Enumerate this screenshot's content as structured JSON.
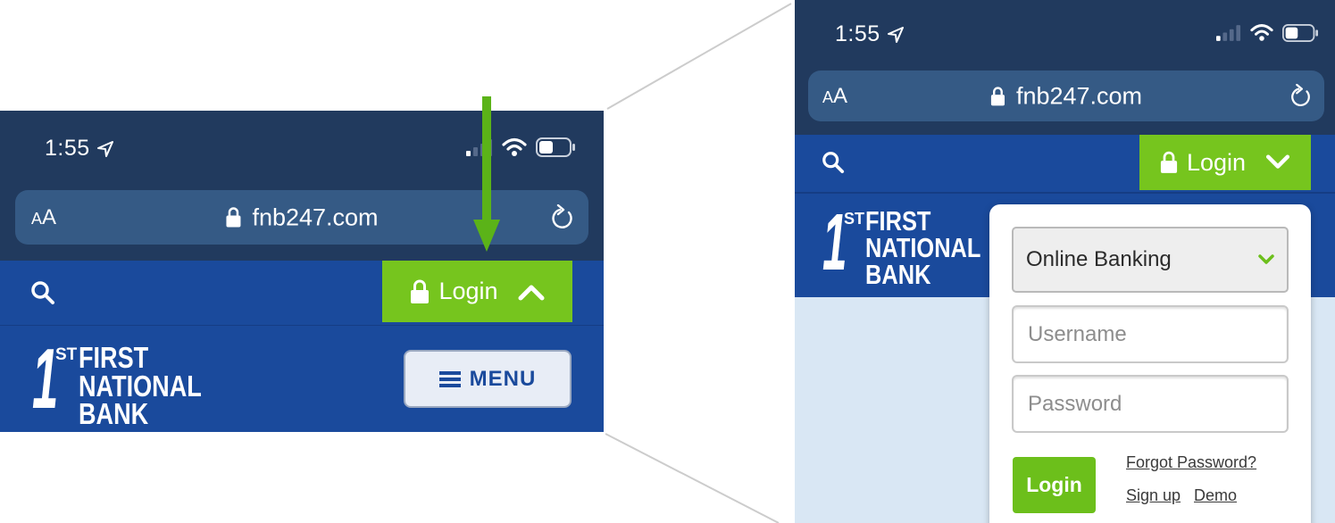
{
  "phone": {
    "time": "1:55",
    "url": "fnb247.com",
    "reader_label_small": "A",
    "reader_label_large": "A"
  },
  "nav": {
    "login_label": "Login",
    "menu_label": "MENU"
  },
  "logo": {
    "numeral": "1",
    "suffix": "ST",
    "line1": "FIRST",
    "line2": "NATIONAL",
    "line3": "BANK"
  },
  "login_panel": {
    "account_type": "Online Banking",
    "username_placeholder": "Username",
    "password_placeholder": "Password",
    "submit_label": "Login",
    "forgot_password": "Forgot Password?",
    "sign_up": "Sign up",
    "demo": "Demo"
  },
  "colors": {
    "status_bar": "#213a5e",
    "url_bar": "#355a85",
    "brand_blue": "#1a4a9c",
    "login_green": "#76c51e",
    "page_background": "#d9e7f4"
  },
  "icons": {
    "location": "location-arrow-icon",
    "signal": "cellular-signal-icon",
    "wifi": "wifi-icon",
    "battery": "battery-icon",
    "lock": "lock-icon",
    "reload": "reload-icon",
    "search": "search-icon",
    "chevron_up": "chevron-up-icon",
    "chevron_down": "chevron-down-icon",
    "hamburger": "hamburger-icon"
  }
}
